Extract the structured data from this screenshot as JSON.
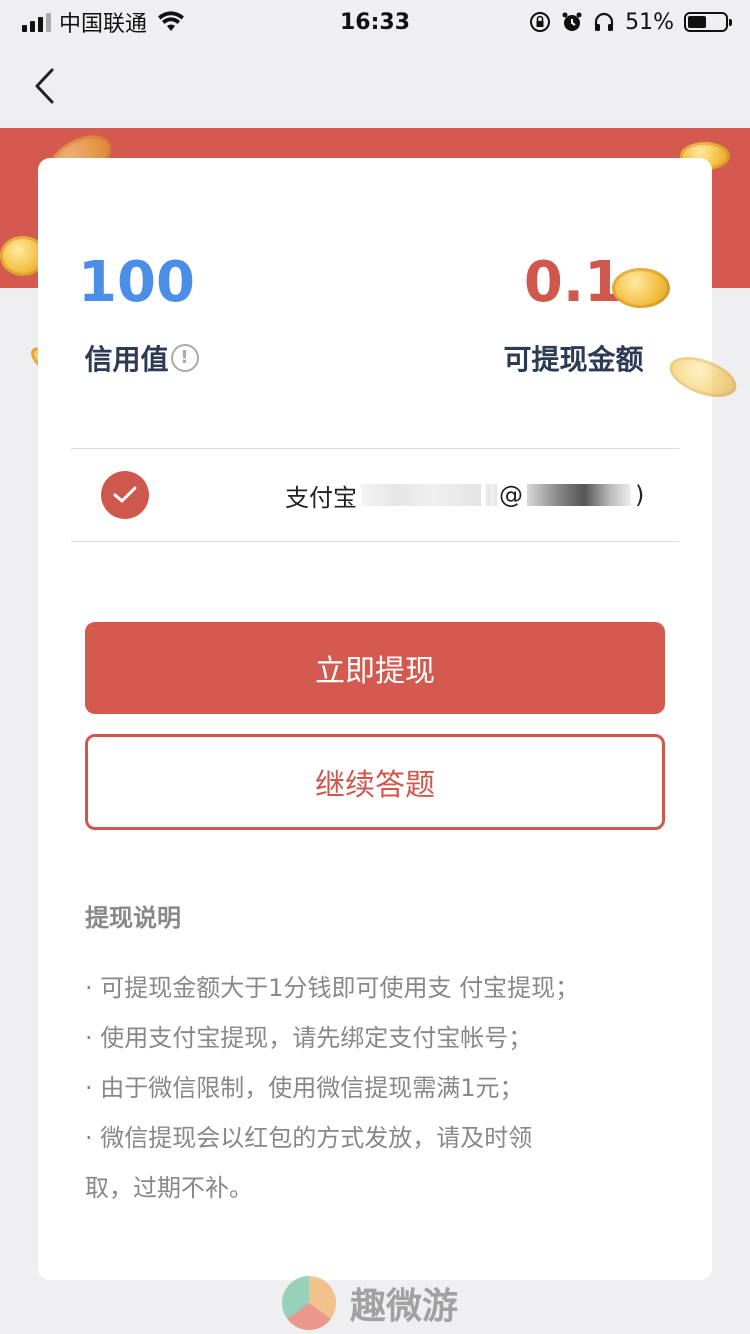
{
  "status_bar": {
    "carrier": "中国联通",
    "time": "16:33",
    "battery": "51%",
    "battery_level": 0.51
  },
  "nav": {
    "back_icon": "chevron-left-icon"
  },
  "stats": {
    "credit_value": "100",
    "credit_label": "信用值",
    "withdrawable_value": "0.1",
    "withdrawable_label": "可提现金额"
  },
  "account": {
    "label": "支付宝",
    "masked_suffix_open": "@",
    "masked_suffix_close": ")"
  },
  "buttons": {
    "withdraw": "立即提现",
    "continue": "继续答题"
  },
  "notes": {
    "title": "提现说明",
    "items": [
      "· 可提现金额大于1分钱即可使用支 付宝提现；",
      "· 使用支付宝提现，请先绑定支付宝帐号；",
      "· 由于微信限制，使用微信提现需满1元；",
      "· 微信提现会以红包的方式发放，请及时领",
      "取，过期不补。"
    ]
  },
  "watermark": {
    "text": "趣微游"
  },
  "colors": {
    "brand_red": "#d45a50",
    "credit_blue": "#4a8ee8"
  }
}
